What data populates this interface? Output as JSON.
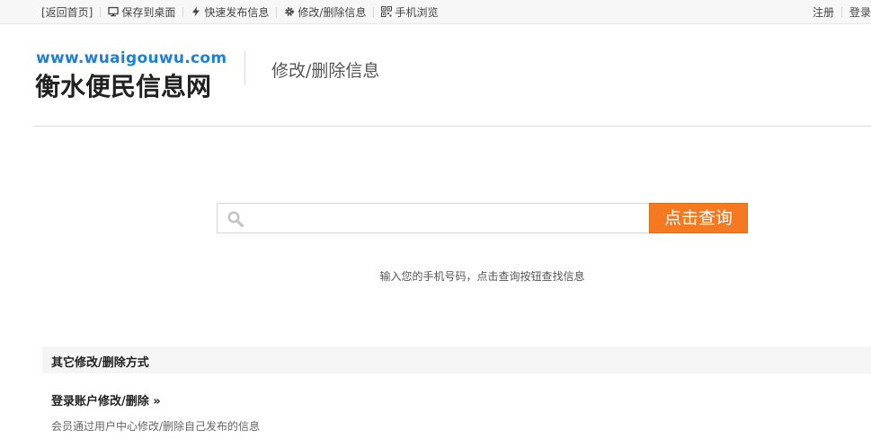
{
  "topbar": {
    "left_items": [
      {
        "label": "[返回首页]",
        "icon": ""
      },
      {
        "label": "保存到桌面",
        "icon": "monitor-icon"
      },
      {
        "label": "快速发布信息",
        "icon": "lightning-icon"
      },
      {
        "label": "修改/删除信息",
        "icon": "gear-icon"
      },
      {
        "label": "手机浏览",
        "icon": "qrcode-icon"
      }
    ],
    "right_items": [
      {
        "label": "注册"
      },
      {
        "label": "登录"
      }
    ]
  },
  "header": {
    "logo_url": "www.wuaigouwu.com",
    "logo_name": "衡水便民信息网",
    "page_title": "修改/删除信息"
  },
  "search": {
    "placeholder": "",
    "button_label": "点击查询",
    "hint": "输入您的手机号码，点击查询按钮查找信息"
  },
  "other": {
    "title": "其它修改/删除方式",
    "method_label": "登录账户修改/删除 »",
    "method_desc": "会员通过用户中心修改/删除自己发布的信息"
  },
  "colors": {
    "accent_orange": "#f47920",
    "logo_blue": "#1e7fd6"
  }
}
